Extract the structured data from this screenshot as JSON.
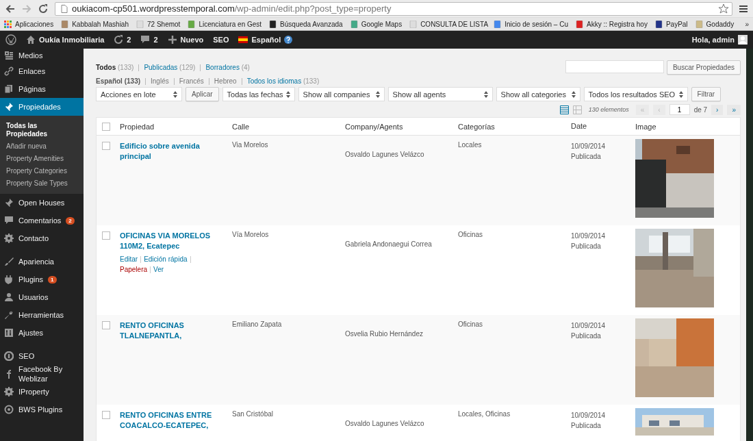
{
  "browser": {
    "url": {
      "host": "oukiacom-cp501.wordpresstemporal.com",
      "path": "/wp-admin/edit.php?post_type=property"
    },
    "bookmarks": [
      {
        "label": "Aplicaciones"
      },
      {
        "label": "Kabbalah Mashiah"
      },
      {
        "label": "72 Shemot"
      },
      {
        "label": "Licenciatura en Gest"
      },
      {
        "label": "Búsqueda Avanzada"
      },
      {
        "label": "Google Maps"
      },
      {
        "label": "CONSULTA DE LISTA"
      },
      {
        "label": "Inicio de sesión – Cu"
      },
      {
        "label": "Akky :: Registra hoy"
      },
      {
        "label": "PayPal"
      },
      {
        "label": "Godaddy"
      }
    ],
    "more": "»"
  },
  "admin_bar": {
    "site": "Oukía Inmobiliaria",
    "updates": "2",
    "comments": "2",
    "new": "Nuevo",
    "seo": "SEO",
    "language": "Español",
    "greeting": "Hola, admin"
  },
  "sidebar": {
    "sections": [
      [
        {
          "label": "Medios",
          "selected": false
        },
        {
          "label": "Enlaces",
          "selected": false
        },
        {
          "label": "Páginas",
          "selected": false
        },
        {
          "label": "Propiedades",
          "selected": true,
          "children": [
            {
              "label": "Todas las Propiedades",
              "selected": true
            },
            {
              "label": "Añadir nueva",
              "selected": false
            },
            {
              "label": "Property Amenities",
              "selected": false
            },
            {
              "label": "Property Categories",
              "selected": false
            },
            {
              "label": "Property Sale Types",
              "selected": false
            }
          ]
        },
        {
          "label": "Open Houses",
          "selected": false
        },
        {
          "label": "Comentarios",
          "selected": false,
          "badge": "2"
        },
        {
          "label": "Contacto",
          "selected": false
        }
      ],
      [
        {
          "label": "Apariencia",
          "selected": false
        },
        {
          "label": "Plugins",
          "selected": false,
          "badge": "1"
        },
        {
          "label": "Usuarios",
          "selected": false
        },
        {
          "label": "Herramientas",
          "selected": false
        },
        {
          "label": "Ajustes",
          "selected": false
        }
      ],
      [
        {
          "label": "SEO",
          "selected": false
        },
        {
          "label": "Facebook By Weblizar",
          "selected": false
        },
        {
          "label": "IProperty",
          "selected": false
        },
        {
          "label": "BWS Plugins",
          "selected": false
        }
      ]
    ]
  },
  "status_links": [
    {
      "label": "Todos",
      "count": "(133)",
      "selected": true
    },
    {
      "label": "Publicadas",
      "count": "(129)",
      "selected": false
    },
    {
      "label": "Borradores",
      "count": "(4)",
      "selected": false
    }
  ],
  "languages": [
    {
      "label": "Español",
      "count": "(133)",
      "kind": "current"
    },
    {
      "label": "Inglés",
      "kind": "plain"
    },
    {
      "label": "Francés",
      "kind": "plain"
    },
    {
      "label": "Hebreo",
      "kind": "plain"
    },
    {
      "label": "Todos los idiomas",
      "count": "(133)",
      "kind": "link"
    }
  ],
  "search": {
    "button": "Buscar Propiedades"
  },
  "bulk": {
    "select": "Acciones en lote",
    "button": "Aplicar"
  },
  "filters": [
    "Todas las fechas",
    "Show all companies",
    "Show all agents",
    "Show all categories",
    "Todos los resultados SEO"
  ],
  "filter_button": "Filtrar",
  "pagination": {
    "views": [
      {
        "selected": true
      },
      {
        "selected": false
      }
    ],
    "count": "130 elementos",
    "first": "«",
    "prev": "‹",
    "page": "1",
    "of": "de 7",
    "next": "›",
    "last": "»",
    "first_disabled": true,
    "prev_disabled": true
  },
  "table": {
    "select_all_checked": false,
    "columns": [
      "Propiedad",
      "Calle",
      "Company/Agents",
      "Categorías",
      "Date",
      "Image"
    ],
    "rows": [
      {
        "checked": false,
        "title": "Edificio sobre avenida principal",
        "street": "Via Morelos",
        "agent": "Osvaldo Lagunes Velázco",
        "categories": "Locales",
        "date": "10/09/2014",
        "status": "Publicada",
        "image": {
          "kind": "picture"
        }
      },
      {
        "checked": false,
        "title": "OFICINAS VIA MORELOS 110M2, Ecatepec",
        "actions": [
          {
            "label": "Editar",
            "kind": "link"
          },
          {
            "label": "Edición rápida",
            "kind": "link"
          },
          {
            "label": "Papelera",
            "kind": "trash"
          },
          {
            "label": "Ver",
            "kind": "link"
          }
        ],
        "street": "Vía Morelos",
        "agent": "Gabriela Andonaegui Correa",
        "categories": "Oficinas",
        "date": "10/09/2014",
        "status": "Publicada",
        "image": {
          "kind": "picture"
        }
      },
      {
        "checked": false,
        "title": "RENTO OFICINAS TLALNEPANTLA,",
        "street": "Emiliano Zapata",
        "agent": "Osvelia Rubio Hernández",
        "categories": "Oficinas",
        "date": "10/09/2014",
        "status": "Publicada",
        "image": {
          "kind": "picture"
        }
      },
      {
        "checked": false,
        "title": "RENTO OFICINAS ENTRE COACALCO-ECATEPEC,",
        "street": "San Cristóbal",
        "agent": "Osvaldo Lagunes Velázco",
        "categories": "Locales, Oficinas",
        "date": "10/09/2014",
        "status": "Publicada",
        "image": {
          "kind": "picture"
        }
      }
    ]
  }
}
